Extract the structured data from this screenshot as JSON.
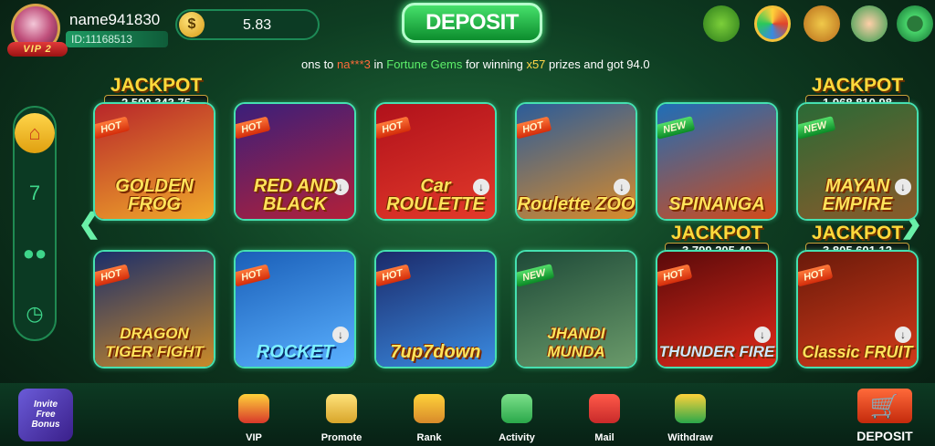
{
  "user": {
    "vip": "VIP 2",
    "name": "name941830",
    "id": "ID:11168513"
  },
  "balance": "5.83",
  "deposit_label": "DEPOSIT",
  "ticker": {
    "pre": "ons to ",
    "user": "na***3",
    "mid": " in ",
    "game": "Fortune Gems",
    "mid2": " for winning ",
    "mult": "x57",
    "post": " prizes and got 94.0"
  },
  "cards": [
    {
      "title": "GOLDEN FROG",
      "tag": "HOT",
      "colors": [
        "#b8262a",
        "#f0a92a"
      ]
    },
    {
      "title": "RED AND BLACK",
      "tag": "HOT",
      "colors": [
        "#3a1f7a",
        "#b2203a"
      ]
    },
    {
      "title": "Car ROULETTE",
      "tag": "HOT",
      "colors": [
        "#b0111b",
        "#e33a2a"
      ]
    },
    {
      "title": "Roulette ZOO",
      "tag": "HOT",
      "colors": [
        "#2b5c9a",
        "#d98b2a"
      ]
    },
    {
      "title": "SPINANGA",
      "tag": "NEW",
      "colors": [
        "#1e6eb8",
        "#d24a1a"
      ]
    },
    {
      "title": "MAYAN EMPIRE",
      "tag": "NEW",
      "colors": [
        "#2a6a36",
        "#8a5a2a"
      ]
    },
    {
      "title": "DRAGON TIGER FIGHT",
      "tag": "HOT",
      "colors": [
        "#1b2e6a",
        "#c98a2a"
      ]
    },
    {
      "title": "ROCKET",
      "tag": "HOT",
      "colors": [
        "#1a5fb8",
        "#5ab0ff"
      ]
    },
    {
      "title": "7up7down",
      "tag": "HOT",
      "colors": [
        "#1b2a6a",
        "#3a8ae0"
      ]
    },
    {
      "title": "JHANDI MUNDA",
      "tag": "NEW",
      "colors": [
        "#1e4a38",
        "#6a9a6a"
      ]
    },
    {
      "title": "THUNDER FIRE",
      "tag": "HOT",
      "colors": [
        "#5a0a0a",
        "#e02a1a"
      ]
    },
    {
      "title": "Classic FRUIT",
      "tag": "HOT",
      "colors": [
        "#6a1a0a",
        "#d23a1a"
      ]
    }
  ],
  "jackpots": [
    {
      "label": "JACKPOT",
      "value": "2,590,343.75"
    },
    {
      "label": "JACKPOT",
      "value": "1,968,810.98"
    },
    {
      "label": "JACKPOT",
      "value": "3,799,205.49"
    },
    {
      "label": "JACKPOT",
      "value": "3,805,601.12"
    }
  ],
  "sidebar": [
    "home-icon",
    "slots-icon",
    "multiplayer-icon",
    "history-icon"
  ],
  "nav": [
    {
      "label": "VIP",
      "icon": "vip-crown-icon",
      "color": "#d8382a"
    },
    {
      "label": "Promote",
      "icon": "promote-coins-icon",
      "color": "#d8a52a"
    },
    {
      "label": "Rank",
      "icon": "rank-trophy-icon",
      "color": "#d88a2a"
    },
    {
      "label": "Activity",
      "icon": "activity-gift-icon",
      "color": "#2aa84a"
    },
    {
      "label": "Mail",
      "icon": "mail-icon",
      "color": "#c82a2a"
    },
    {
      "label": "Withdraw",
      "icon": "withdraw-icon",
      "color": "#e0a02a"
    }
  ],
  "invite": {
    "line1": "Invite",
    "line2": "Free",
    "line3": "Bonus"
  },
  "top_icons": [
    "bonus-mascot-icon",
    "wheel-icon",
    "gift-icon",
    "support-icon",
    "settings-icon"
  ]
}
